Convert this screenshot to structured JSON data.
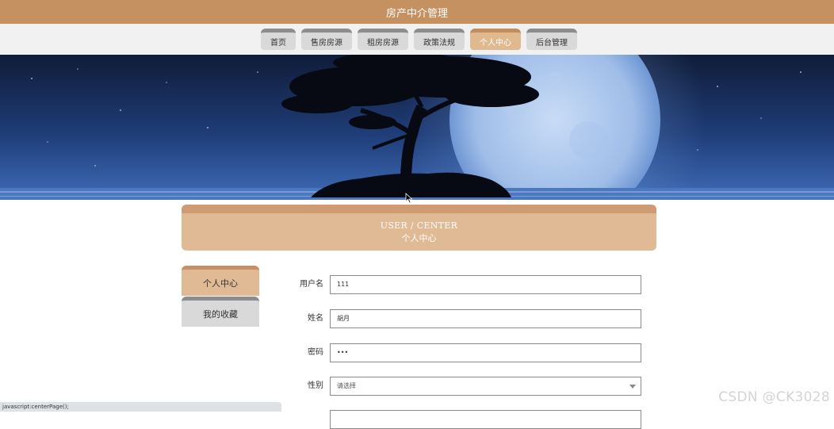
{
  "header": {
    "title": "房产中介管理"
  },
  "nav": {
    "tabs": [
      {
        "label": "首页"
      },
      {
        "label": "售房房源"
      },
      {
        "label": "租房房源"
      },
      {
        "label": "政策法规"
      },
      {
        "label": "个人中心",
        "active": true
      },
      {
        "label": "后台管理"
      }
    ]
  },
  "banner": {
    "image": "moonlit-tree-icon"
  },
  "section": {
    "title_en": "USER / CENTER",
    "title_cn": "个人中心"
  },
  "sidebar": {
    "items": [
      {
        "label": "个人中心",
        "active": true
      },
      {
        "label": "我的收藏"
      }
    ]
  },
  "form": {
    "username_label": "用户名",
    "username_value": "111",
    "name_label": "姓名",
    "name_value": "胡月",
    "password_label": "密码",
    "password_value": "•••",
    "gender_label": "性别",
    "gender_value": "请选择"
  },
  "status": {
    "text": "javascript:centerPage();"
  },
  "watermark": {
    "text": "CSDN @CK3028"
  },
  "colors": {
    "brand": "#c59160",
    "accent_light": "#e0b995",
    "tab_gray": "#d9d9d9"
  }
}
